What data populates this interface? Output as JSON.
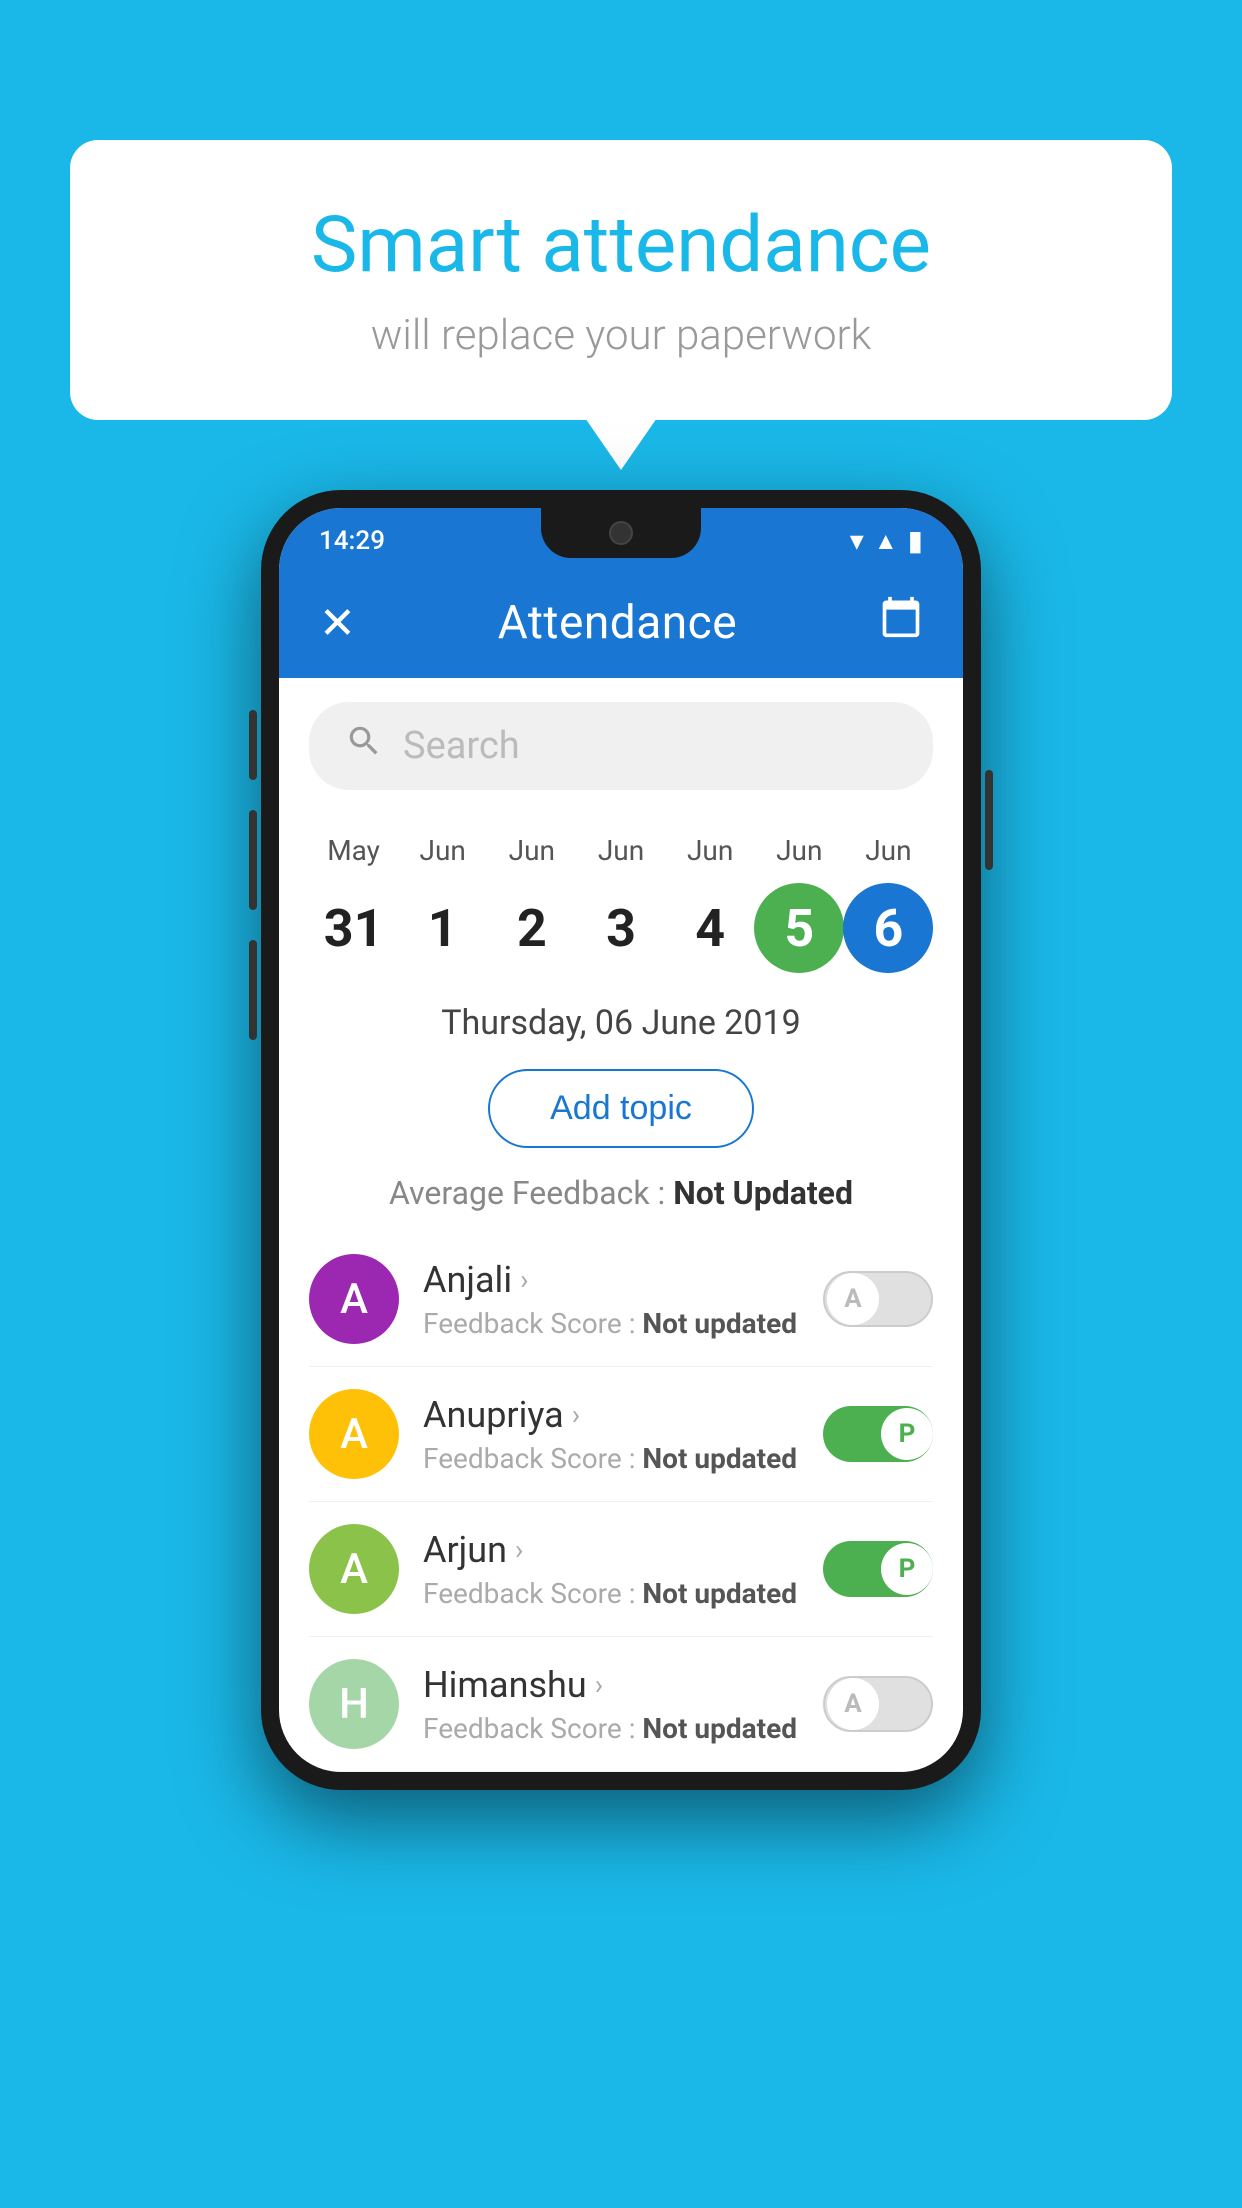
{
  "background_color": "#1ab8e8",
  "speech_bubble": {
    "title": "Smart attendance",
    "subtitle": "will replace your paperwork"
  },
  "status_bar": {
    "time": "14:29",
    "wifi": "wifi",
    "signal": "signal",
    "battery": "battery"
  },
  "app_bar": {
    "close_icon": "✕",
    "title": "Attendance",
    "calendar_icon": "📅"
  },
  "search": {
    "placeholder": "Search"
  },
  "calendar": {
    "days": [
      {
        "month": "May",
        "day": "31",
        "active": ""
      },
      {
        "month": "Jun",
        "day": "1",
        "active": ""
      },
      {
        "month": "Jun",
        "day": "2",
        "active": ""
      },
      {
        "month": "Jun",
        "day": "3",
        "active": ""
      },
      {
        "month": "Jun",
        "day": "4",
        "active": ""
      },
      {
        "month": "Jun",
        "day": "5",
        "active": "green"
      },
      {
        "month": "Jun",
        "day": "6",
        "active": "blue"
      }
    ],
    "selected_date": "Thursday, 06 June 2019"
  },
  "add_topic_label": "Add topic",
  "avg_feedback_label": "Average Feedback :",
  "avg_feedback_value": "Not Updated",
  "students": [
    {
      "name": "Anjali",
      "avatar_letter": "A",
      "avatar_color": "#9c27b0",
      "feedback_label": "Feedback Score :",
      "feedback_value": "Not updated",
      "toggle": "off",
      "toggle_letter": "A"
    },
    {
      "name": "Anupriya",
      "avatar_letter": "A",
      "avatar_color": "#ffc107",
      "feedback_label": "Feedback Score :",
      "feedback_value": "Not updated",
      "toggle": "on",
      "toggle_letter": "P"
    },
    {
      "name": "Arjun",
      "avatar_letter": "A",
      "avatar_color": "#8bc34a",
      "feedback_label": "Feedback Score :",
      "feedback_value": "Not updated",
      "toggle": "on",
      "toggle_letter": "P"
    },
    {
      "name": "Himanshu",
      "avatar_letter": "H",
      "avatar_color": "#a5d6a7",
      "feedback_label": "Feedback Score :",
      "feedback_value": "Not updated",
      "toggle": "off",
      "toggle_letter": "A"
    }
  ]
}
